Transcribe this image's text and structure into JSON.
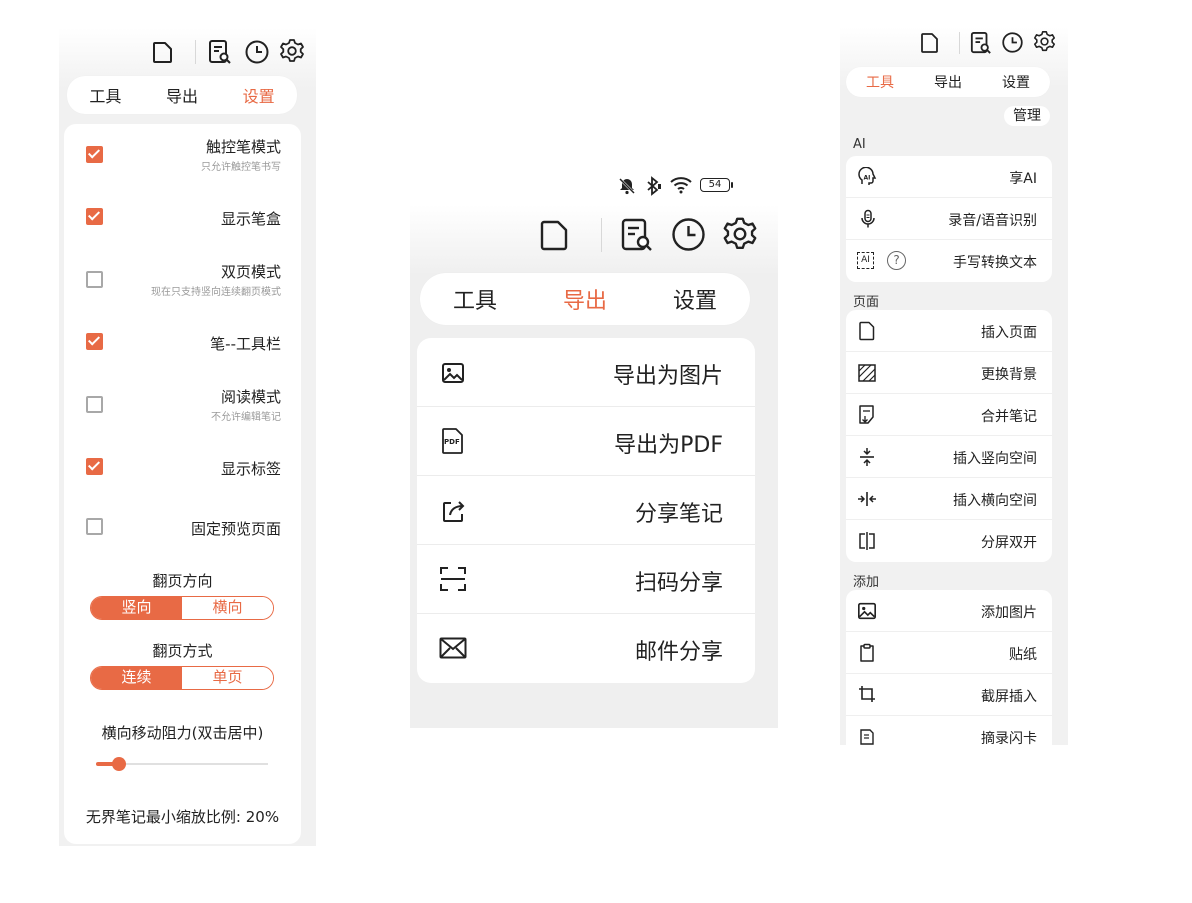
{
  "colors": {
    "accent": "#e86a45",
    "bg": "#f1f1f1",
    "card": "#ffffff",
    "checkbox_off": "#a8a8a8"
  },
  "tabs": {
    "tools": "工具",
    "export": "导出",
    "settings": "设置"
  },
  "settings_panel": {
    "items": [
      {
        "label": "触控笔模式",
        "sub": "只允许触控笔书写",
        "checked": true
      },
      {
        "label": "显示笔盒",
        "sub": "",
        "checked": true
      },
      {
        "label": "双页模式",
        "sub": "现在只支持竖向连续翻页模式",
        "checked": false
      },
      {
        "label": "笔--工具栏",
        "sub": "",
        "checked": true
      },
      {
        "label": "阅读模式",
        "sub": "不允许编辑笔记",
        "checked": false
      },
      {
        "label": "显示标签",
        "sub": "",
        "checked": true
      },
      {
        "label": "固定预览页面",
        "sub": "",
        "checked": false
      }
    ],
    "flip_direction": {
      "title": "翻页方向",
      "options": [
        "竖向",
        "横向"
      ],
      "selected": "竖向"
    },
    "flip_mode": {
      "title": "翻页方式",
      "options": [
        "连续",
        "单页"
      ],
      "selected": "连续"
    },
    "resistance": {
      "title": "横向移动阻力(双击居中)",
      "value": 0.1
    },
    "min_zoom": "无界笔记最小缩放比例: 20%"
  },
  "status_bar": {
    "battery": "54"
  },
  "export_panel": {
    "items": [
      {
        "label": "导出为图片",
        "icon": "image-icon"
      },
      {
        "label": "导出为PDF",
        "icon": "pdf-icon"
      },
      {
        "label": "分享笔记",
        "icon": "share-icon"
      },
      {
        "label": "扫码分享",
        "icon": "scan-icon"
      },
      {
        "label": "邮件分享",
        "icon": "mail-icon"
      }
    ],
    "pdf_icon_text": "PDF"
  },
  "tools_panel": {
    "manage": "管理",
    "sections": [
      {
        "title": "AI",
        "items": [
          {
            "label": "享AI",
            "icon": "ai-assistant-icon"
          },
          {
            "label": "录音/语音识别",
            "icon": "microphone-icon"
          },
          {
            "label": "手写转换文本",
            "icon": "handwriting-to-text-icon"
          }
        ]
      },
      {
        "title": "页面",
        "items": [
          {
            "label": "插入页面",
            "icon": "page-icon"
          },
          {
            "label": "更换背景",
            "icon": "background-icon"
          },
          {
            "label": "合并笔记",
            "icon": "merge-icon"
          },
          {
            "label": "插入竖向空间",
            "icon": "vertical-space-icon"
          },
          {
            "label": "插入横向空间",
            "icon": "horizontal-space-icon"
          },
          {
            "label": "分屏双开",
            "icon": "split-screen-icon"
          }
        ]
      },
      {
        "title": "添加",
        "items": [
          {
            "label": "添加图片",
            "icon": "image-icon"
          },
          {
            "label": "贴纸",
            "icon": "sticker-icon"
          },
          {
            "label": "截屏插入",
            "icon": "crop-icon"
          },
          {
            "label": "摘录闪卡",
            "icon": "flashcard-icon"
          }
        ]
      }
    ],
    "ai_badge": "AI",
    "help": "?"
  }
}
